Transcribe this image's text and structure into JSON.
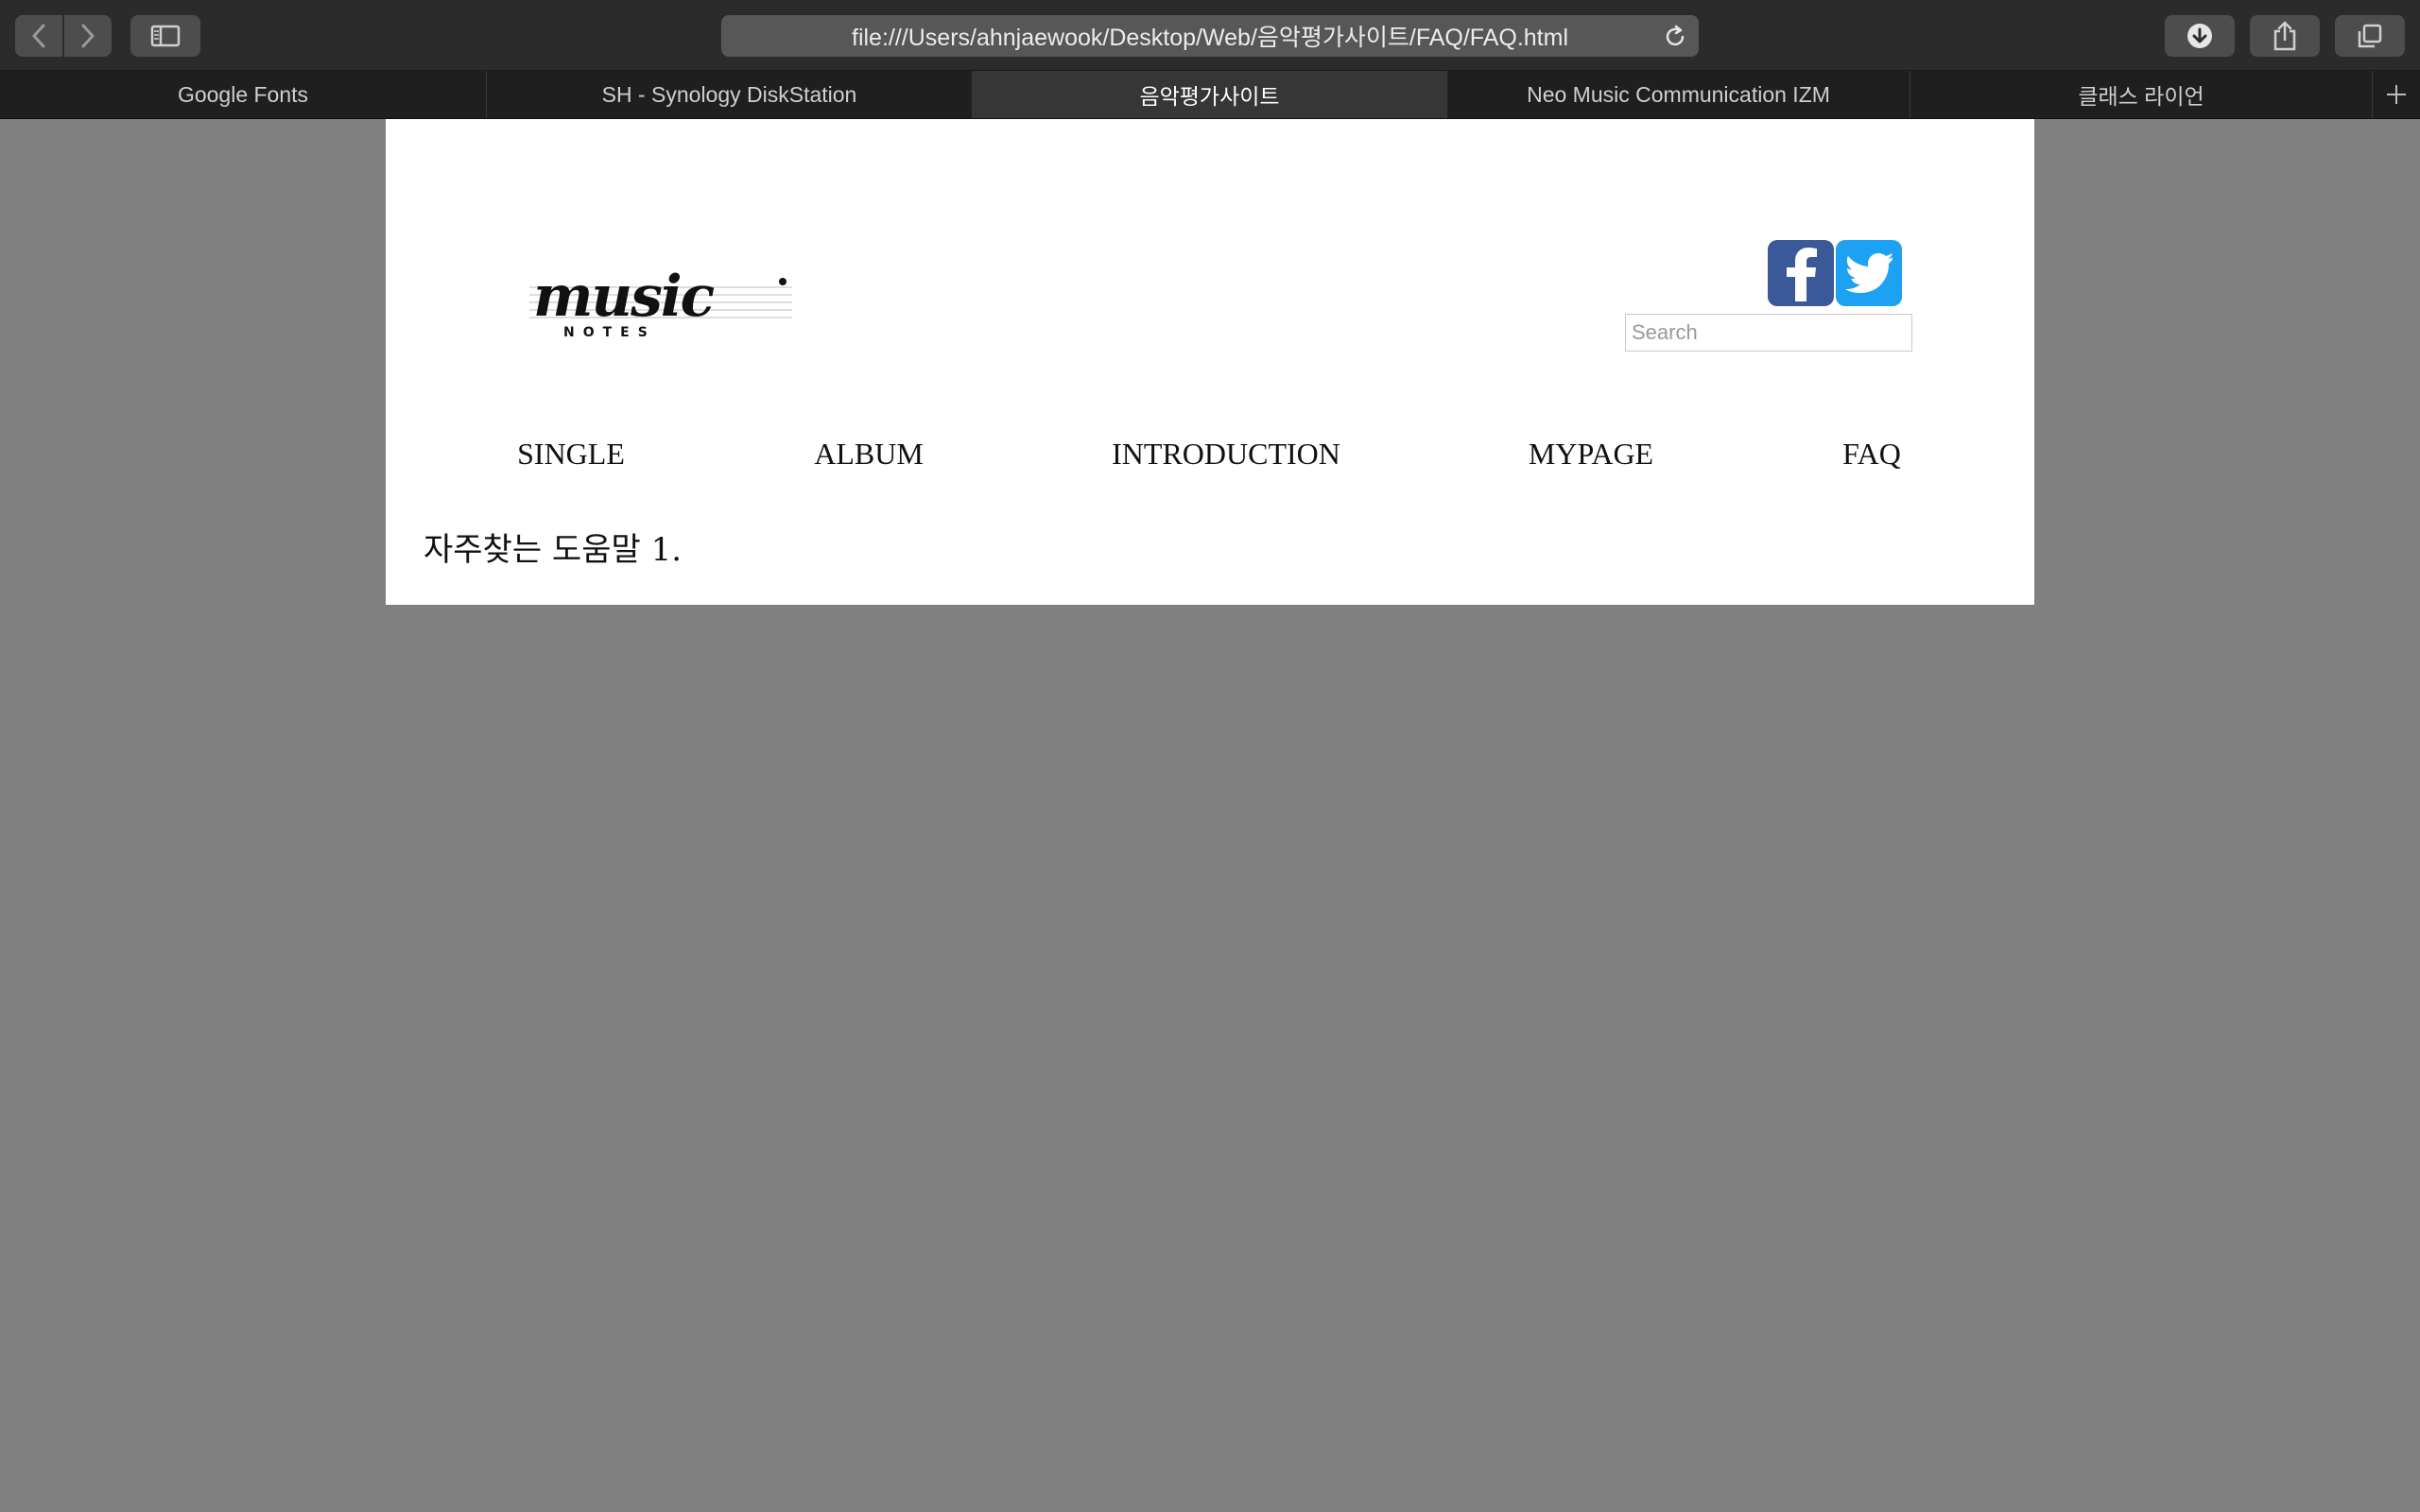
{
  "browser": {
    "url": "file:///Users/ahnjaewook/Desktop/Web/음악평가사이트/FAQ/FAQ.html",
    "tabs": [
      {
        "label": "Google Fonts",
        "active": false
      },
      {
        "label": "SH - Synology DiskStation",
        "active": false
      },
      {
        "label": "음악평가사이트",
        "active": true
      },
      {
        "label": "Neo Music Communication IZM",
        "active": false
      },
      {
        "label": "클래스 라이언",
        "active": false
      }
    ],
    "icons": [
      "back-icon",
      "forward-icon",
      "sidebar-icon",
      "reload-icon",
      "download-icon",
      "share-icon",
      "tabs-overview-icon",
      "new-tab-icon"
    ]
  },
  "site": {
    "logo_text": "music",
    "logo_subtext": "NOTES",
    "search_placeholder": "Search",
    "social": [
      "facebook-icon",
      "twitter-icon"
    ],
    "nav": [
      "SINGLE",
      "ALBUM",
      "INTRODUCTION",
      "MYPAGE",
      "FAQ"
    ],
    "heading": "자주찾는 도움말 1."
  },
  "colors": {
    "background": "#808080",
    "facebook": "#3b5998",
    "twitter": "#1da1f2"
  }
}
